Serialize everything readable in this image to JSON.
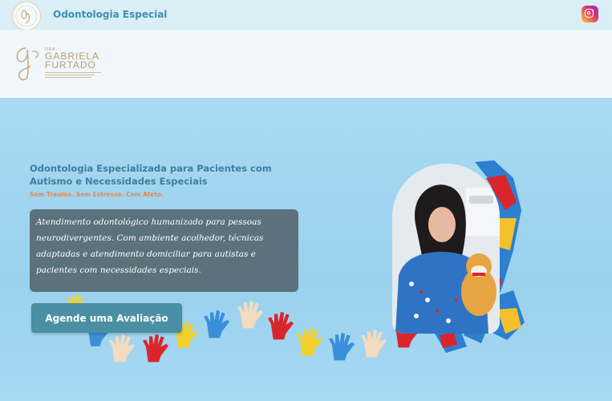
{
  "topbar": {
    "site_title": "Odontologia Especial",
    "logo_icon": "clinic-logo-icon",
    "instagram_icon": "instagram-icon"
  },
  "brand": {
    "small": "DRA.",
    "name_line1": "GABRIELA",
    "name_line2": "FURTADO"
  },
  "hero": {
    "title": "Odontologia Especializada para Pacientes com Autismo e Necessidades Especiais",
    "tagline": "Sem Trauma. Sem Estresse. Com Afeto.",
    "description": "Atendimento odontológico humanizado para pessoas neurodivergentes. Com ambiente acolhedor, técnicas adaptadas e atendimento domiciliar para autistas e pacientes com necessidades especiais.",
    "cta_label": "Agende uma Avaliação"
  },
  "colors": {
    "accent": "#3f8fb0",
    "cta": "#4a8fa3",
    "tagline": "#e08a52",
    "hero_bg": "#9ad1ee"
  }
}
